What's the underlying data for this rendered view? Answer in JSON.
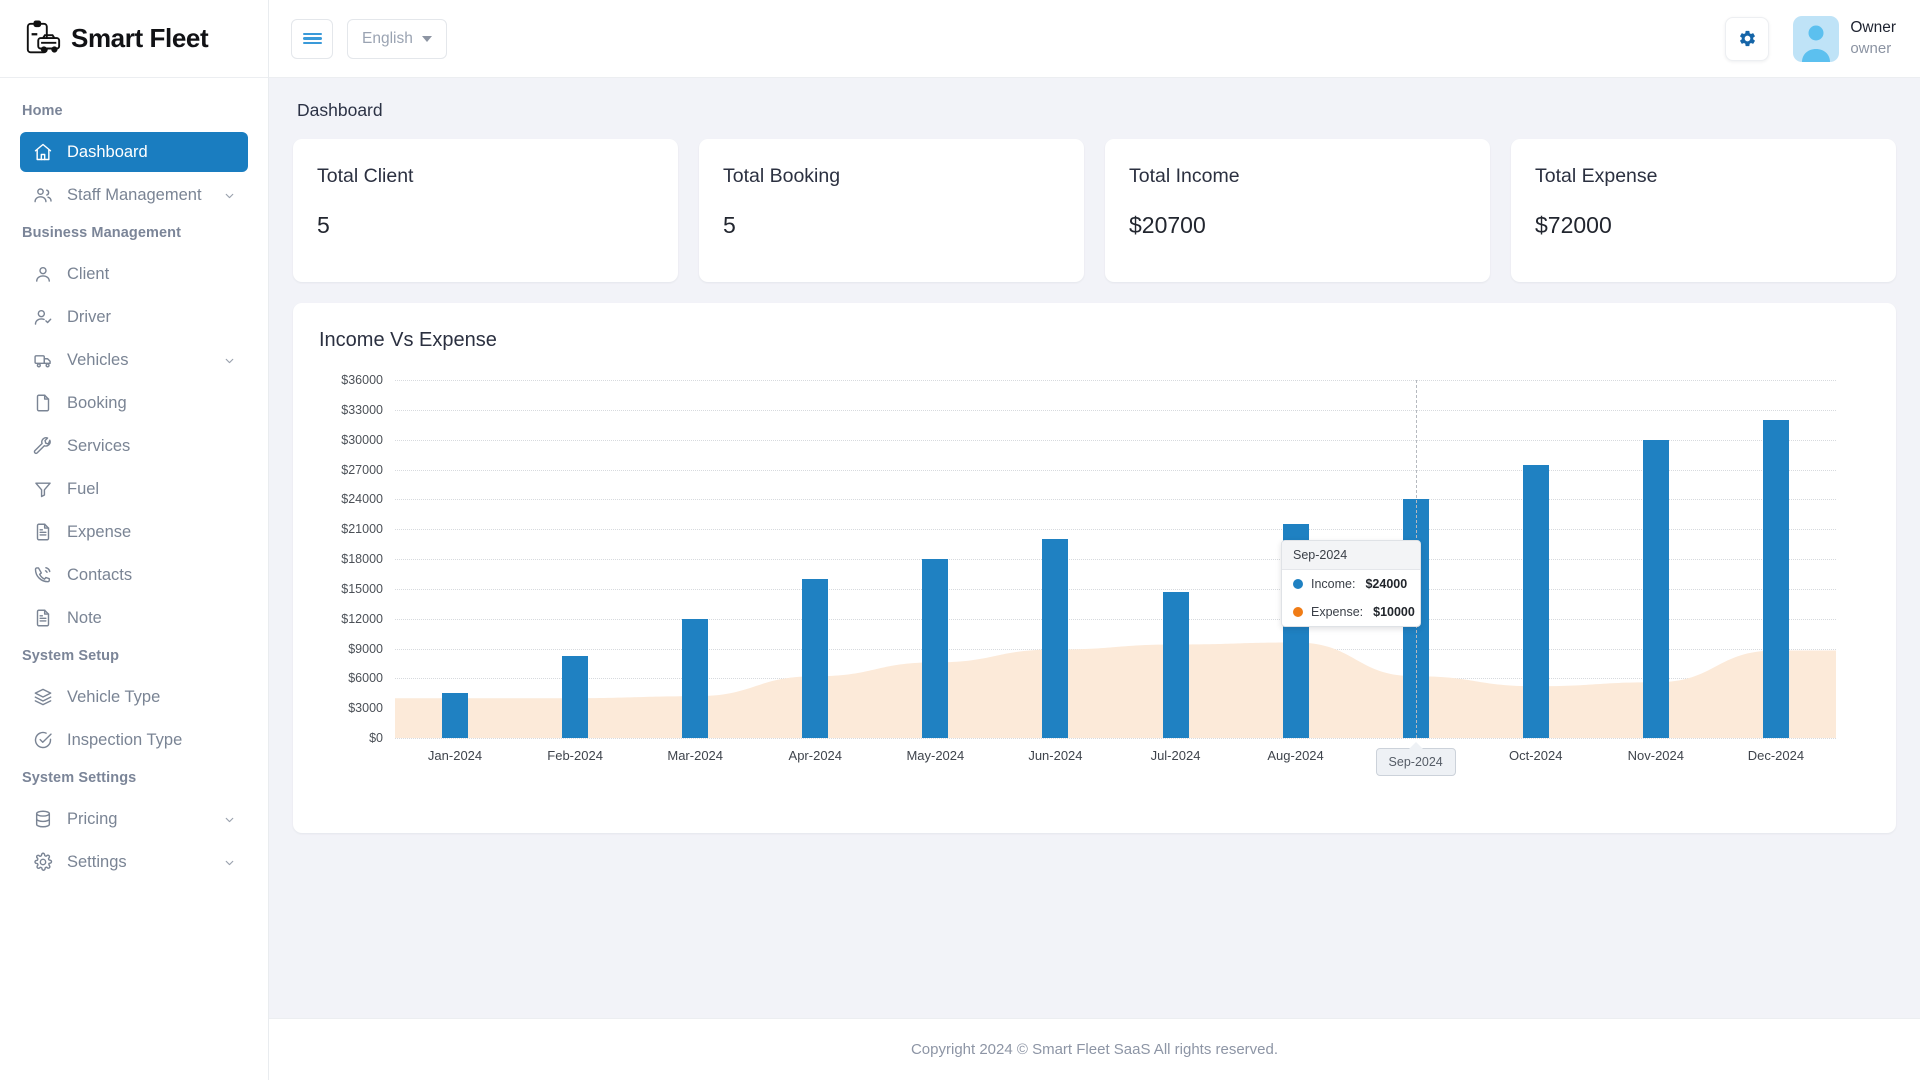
{
  "brand": {
    "name": "Smart Fleet",
    "logo_icon": "clipboard-car-icon"
  },
  "topbar": {
    "menu_toggle_icon": "hamburger-icon",
    "language_label": "English",
    "language_caret_icon": "caret-down-icon",
    "settings_icon": "gear-icon",
    "avatar_icon": "user-avatar-icon",
    "user_name": "Owner",
    "user_role": "owner"
  },
  "sidebar": {
    "groups": [
      {
        "heading": "Home",
        "items": [
          {
            "label": "Dashboard",
            "icon": "home-icon",
            "active": true,
            "expandable": false
          }
        ]
      },
      {
        "heading": null,
        "items": [
          {
            "label": "Staff Management",
            "icon": "users-icon",
            "active": false,
            "expandable": true
          }
        ]
      },
      {
        "heading": "Business Management",
        "items": [
          {
            "label": "Client",
            "icon": "user-icon",
            "active": false,
            "expandable": false
          },
          {
            "label": "Driver",
            "icon": "user-check-icon",
            "active": false,
            "expandable": false
          },
          {
            "label": "Vehicles",
            "icon": "truck-icon",
            "active": false,
            "expandable": true
          },
          {
            "label": "Booking",
            "icon": "file-icon",
            "active": false,
            "expandable": false
          },
          {
            "label": "Services",
            "icon": "wrench-icon",
            "active": false,
            "expandable": false
          },
          {
            "label": "Fuel",
            "icon": "funnel-icon",
            "active": false,
            "expandable": false
          },
          {
            "label": "Expense",
            "icon": "file-text-icon",
            "active": false,
            "expandable": false
          },
          {
            "label": "Contacts",
            "icon": "phone-icon",
            "active": false,
            "expandable": false
          },
          {
            "label": "Note",
            "icon": "file-text-icon",
            "active": false,
            "expandable": false
          }
        ]
      },
      {
        "heading": "System Setup",
        "items": [
          {
            "label": "Vehicle Type",
            "icon": "layers-icon",
            "active": false,
            "expandable": false
          },
          {
            "label": "Inspection Type",
            "icon": "check-circle-icon",
            "active": false,
            "expandable": false
          }
        ]
      },
      {
        "heading": "System Settings",
        "items": [
          {
            "label": "Pricing",
            "icon": "database-icon",
            "active": false,
            "expandable": true
          },
          {
            "label": "Settings",
            "icon": "gear-icon",
            "active": false,
            "expandable": true
          }
        ]
      }
    ]
  },
  "page": {
    "title": "Dashboard"
  },
  "stat_cards": [
    {
      "label": "Total Client",
      "value": "5"
    },
    {
      "label": "Total Booking",
      "value": "5"
    },
    {
      "label": "Total Income",
      "value": "$20700"
    },
    {
      "label": "Total Expense",
      "value": "$72000"
    }
  ],
  "chart_panel": {
    "title": "Income Vs Expense"
  },
  "chart_data": {
    "type": "bar",
    "title": "Income Vs Expense",
    "xlabel": "",
    "ylabel": "",
    "ylim": [
      0,
      36000
    ],
    "grid": true,
    "legend_position": "none",
    "categories": [
      "Jan-2024",
      "Feb-2024",
      "Mar-2024",
      "Apr-2024",
      "May-2024",
      "Jun-2024",
      "Jul-2024",
      "Aug-2024",
      "Sep-2024",
      "Oct-2024",
      "Nov-2024",
      "Dec-2024"
    ],
    "y_ticks": [
      "$0",
      "$3000",
      "$6000",
      "$9000",
      "$12000",
      "$15000",
      "$18000",
      "$21000",
      "$24000",
      "$27000",
      "$30000",
      "$33000",
      "$36000"
    ],
    "y_tick_values": [
      0,
      3000,
      6000,
      9000,
      12000,
      15000,
      18000,
      21000,
      24000,
      27000,
      30000,
      33000,
      36000
    ],
    "series": [
      {
        "name": "Income",
        "type": "bar",
        "color": "#1f81c2",
        "values": [
          4500,
          8200,
          12000,
          16000,
          18000,
          20000,
          14700,
          21500,
          24000,
          27500,
          30000,
          32000
        ]
      },
      {
        "name": "Expense",
        "type": "area",
        "color": "#fcead9",
        "values": [
          4000,
          4000,
          4200,
          6200,
          7600,
          8900,
          9400,
          9600,
          6200,
          5200,
          5600,
          8800
        ]
      }
    ],
    "selected_category": "Sep-2024",
    "tooltip": {
      "title": "Sep-2024",
      "rows": [
        {
          "dot_color": "#1f81c2",
          "label": "Income:",
          "value": "$24000"
        },
        {
          "dot_color": "#f07c16",
          "label": "Expense:",
          "value": "$10000"
        }
      ]
    }
  },
  "footer": {
    "text": "Copyright 2024 © Smart Fleet SaaS All rights reserved."
  },
  "colors": {
    "accent": "#1a7dc0",
    "bar": "#1f81c2",
    "expense": "#f07c16",
    "page_bg": "#f2f3f8"
  }
}
